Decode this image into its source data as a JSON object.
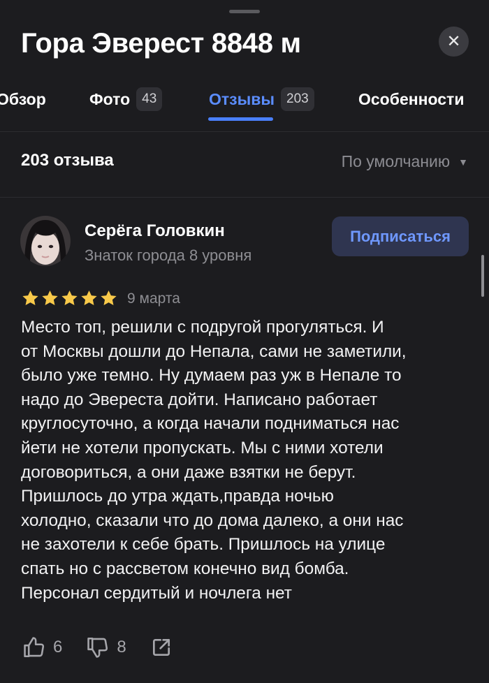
{
  "place": {
    "title": "Гора Эверест 8848 м"
  },
  "tabs": [
    {
      "label": "Обзор"
    },
    {
      "label": "Фото",
      "count": "43"
    },
    {
      "label": "Отзывы",
      "count": "203",
      "active": true
    },
    {
      "label": "Особенности"
    }
  ],
  "reviews": {
    "count_label": "203 отзыва",
    "sort_label": "По умолчанию"
  },
  "review": {
    "author": "Серёга Головкин",
    "status": "Знаток города 8 уровня",
    "subscribe_label": "Подписаться",
    "rating": 5,
    "date": "9 марта",
    "lines": [
      "Место топ, решили с подругой прогуляться. И",
      "от Москвы дошли до Непала, сами не заметили,",
      "было уже темно. Ну думаем раз уж в Непале то",
      "надо до Эвереста дойти. Написано работает",
      "круглосуточно, а когда начали подниматься нас",
      "йети не хотели пропускать. Мы с ними хотели",
      "договориться, а они даже взятки не берут.",
      "Пришлось до утра ждать,правда ночью",
      "холодно, сказали что до дома далеко, а они нас",
      "не захотели к себе брать. Пришлось на улице",
      "спать но с рассветом конечно вид бомба.",
      "Персонал сердитый и ночлега нет"
    ],
    "likes": "6",
    "dislikes": "8"
  },
  "colors": {
    "background": "#1c1c1f",
    "accent": "#4a80ff",
    "star": "#f8c94a"
  },
  "icons": [
    "close-icon",
    "sort-caret-icon",
    "star-icon",
    "thumbs-up-icon",
    "thumbs-down-icon",
    "share-icon"
  ]
}
